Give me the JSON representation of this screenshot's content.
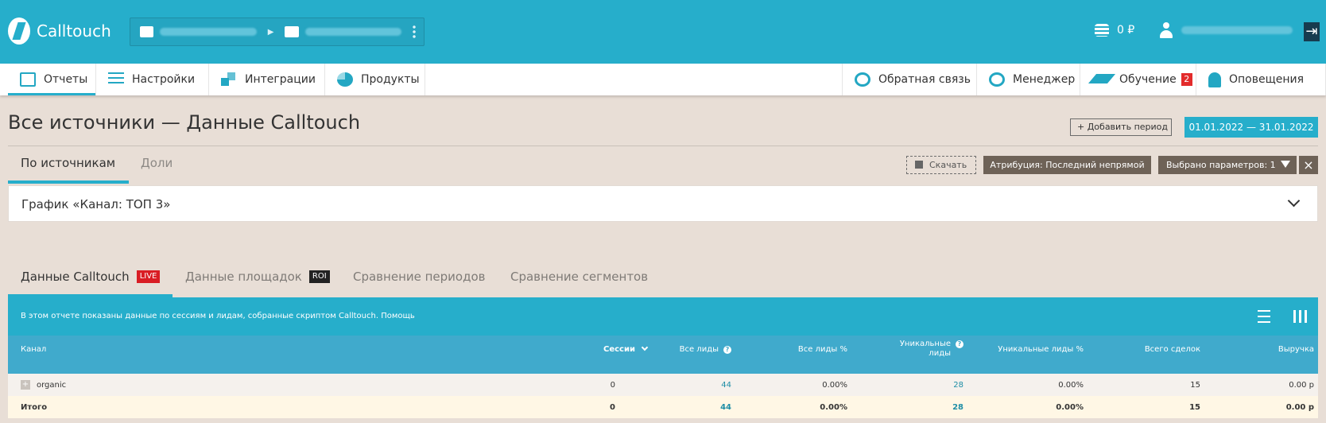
{
  "brand": {
    "name": "Calltouch"
  },
  "header": {
    "balance": "0 ₽"
  },
  "nav": {
    "left": [
      {
        "label": "Отчеты"
      },
      {
        "label": "Настройки"
      },
      {
        "label": "Интеграции"
      },
      {
        "label": "Продукты"
      }
    ],
    "right": [
      {
        "label": "Обратная связь"
      },
      {
        "label": "Менеджер"
      },
      {
        "label": "Обучение",
        "badge": "2"
      },
      {
        "label": "Оповещения"
      }
    ]
  },
  "page": {
    "title": "Все источники — Данные Calltouch",
    "add_period": "+ Добавить период",
    "date_range": "01.01.2022  —  31.01.2022",
    "subtabs": [
      "По источникам",
      "Доли"
    ],
    "download": "Скачать",
    "attribution": "Атрибуция: Последний непрямой",
    "params": "Выбрано параметров: 1"
  },
  "chart_panel": {
    "title": "График «Канал: ТОП 3»"
  },
  "data_tabs": [
    {
      "label": "Данные Calltouch",
      "badge": "LIVE"
    },
    {
      "label": "Данные площадок",
      "badge": "ROI"
    },
    {
      "label": "Сравнение периодов"
    },
    {
      "label": "Сравнение сегментов"
    }
  ],
  "table": {
    "info": "В этом отчете показаны данные по сессиям и лидам, собранные скриптом Calltouch.  Помощь",
    "headers": {
      "channel": "Канал",
      "sessions": "Сессии",
      "all_leads": "Все лиды",
      "all_leads_pct": "Все лиды %",
      "unique_leads_1": "Уникальные",
      "unique_leads_2": "лиды",
      "unique_leads_pct": "Уникальные лиды %",
      "deals": "Всего сделок",
      "revenue": "Выручка"
    },
    "rows": [
      {
        "channel": "organic",
        "sessions": "0",
        "all_leads": "44",
        "all_leads_pct": "0.00%",
        "unique_leads": "28",
        "unique_leads_pct": "0.00%",
        "deals": "15",
        "revenue": "0.00 р"
      }
    ],
    "total": {
      "channel": "Итого",
      "sessions": "0",
      "all_leads": "44",
      "all_leads_pct": "0.00%",
      "unique_leads": "28",
      "unique_leads_pct": "0.00%",
      "deals": "15",
      "revenue": "0.00 р"
    }
  }
}
